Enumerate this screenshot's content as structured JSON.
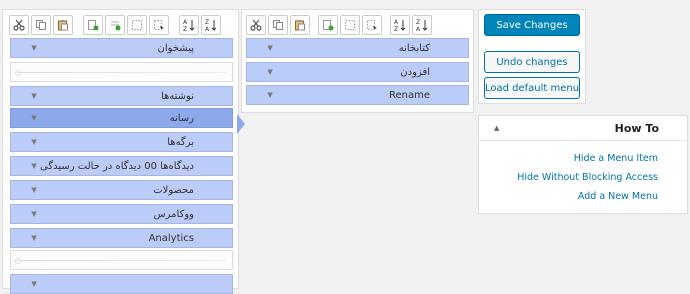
{
  "left_menu": {
    "items": [
      {
        "label": "پیشخوان"
      },
      {
        "separator": true
      },
      {
        "label": "نوشته‌ها"
      },
      {
        "label": "رسانه",
        "selected": true
      },
      {
        "label": "برگه‌ها"
      },
      {
        "label": "دیدگاه‌ها 00 دیدگاه در حالت رسیدگی"
      },
      {
        "label": "محصولات"
      },
      {
        "label": "ووکامرس"
      },
      {
        "label": "Analytics"
      },
      {
        "separator": true
      },
      {
        "label": ""
      }
    ]
  },
  "submenu": {
    "items": [
      {
        "label": "کتابخانه"
      },
      {
        "label": "افزودن"
      },
      {
        "label": "Rename"
      }
    ]
  },
  "toolbar_icons": [
    "cut-icon",
    "copy-icon",
    "paste-icon",
    "new-menu-icon",
    "new-separator-icon",
    "hide-icon",
    "show-icon",
    "sort-ascending-icon",
    "sort-descending-icon"
  ],
  "actions": {
    "save_label": "Save Changes",
    "undo_label": "Undo changes",
    "default_label": "Load default menu"
  },
  "howto": {
    "title": "How To",
    "links": [
      "Hide a Menu Item",
      "Hide Without Blocking Access",
      "Add a New Menu"
    ]
  },
  "colors": {
    "item_bg": "#bcccf8",
    "item_selected_bg": "#8ea8ec",
    "primary": "#0085ba",
    "link": "#0073aa"
  }
}
